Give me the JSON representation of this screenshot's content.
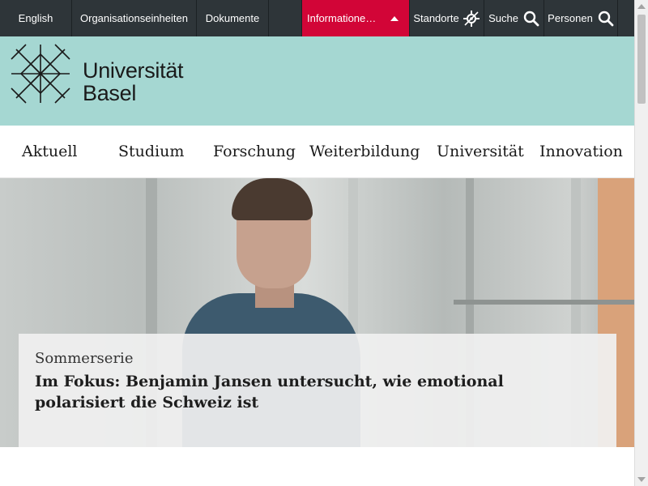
{
  "topbar": {
    "english": "English",
    "org_units": "Organisationseinheiten",
    "documents": "Dokumente",
    "information": "Informatione…",
    "locations": "Standorte",
    "search": "Suche",
    "people": "Personen",
    "accent_color": "#d20537"
  },
  "brand": {
    "line1": "Universität",
    "line2": "Basel",
    "background_color": "#a5d7d2"
  },
  "nav": {
    "items": [
      "Aktuell",
      "Studium",
      "Forschung",
      "Weiterbildung",
      "Universität",
      "Innovation"
    ]
  },
  "hero": {
    "kicker": "Sommerserie",
    "headline": "Im Fokus: Benjamin Jansen untersucht, wie emotional polarisiert die Schweiz ist"
  },
  "icons": {
    "locations": "location-icon",
    "search": "search-icon",
    "people": "people-search-icon",
    "caret": "caret-up-icon",
    "logo": "university-logo-icon"
  }
}
